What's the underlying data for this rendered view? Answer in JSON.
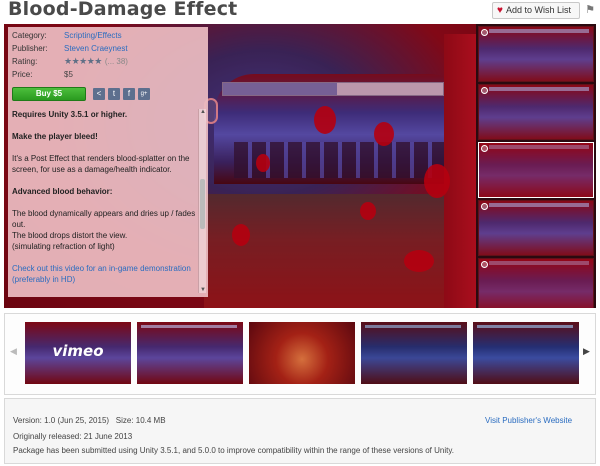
{
  "header": {
    "title": "Blood-Damage Effect",
    "wishlist_label": "Add to Wish List",
    "wishlist_icon": "heart-icon",
    "flag_icon": "flag-icon"
  },
  "info": {
    "category_label": "Category:",
    "category_value": "Scripting/Effects",
    "publisher_label": "Publisher:",
    "publisher_value": "Steven Craeynest",
    "rating_label": "Rating:",
    "rating_stars": "★★★★★",
    "rating_count": "(... 38)",
    "price_label": "Price:",
    "price_value": "$5",
    "buy_label": "Buy $5",
    "share_icons": [
      "share-icon",
      "twitter-icon",
      "facebook-icon",
      "google-plus-icon"
    ],
    "share_glyphs": [
      "<",
      "t",
      "f",
      "g+"
    ]
  },
  "description": {
    "line1": "Requires Unity 3.5.1 or higher.",
    "line2": "Make the player bleed!",
    "line3": "It's a Post Effect that renders blood-splatter on the screen, for use as a damage/health indicator.",
    "line4": "Advanced blood behavior:",
    "line5": "The blood dynamically appears and dries up / fades out.",
    "line6": "The blood drops distort the view.",
    "line7": "(simulating refraction of light)",
    "line8": "Check out this video for an in-game demonstration (preferably in HD)"
  },
  "carousel": {
    "prev_icon": "chevron-left-icon",
    "next_icon": "chevron-right-icon",
    "prev_glyph": "◀",
    "next_glyph": "▶",
    "vimeo_label": "vimeo"
  },
  "footer": {
    "version_line": "Version: 1.0 (Jun 25, 2015)   Size: 10.4 MB",
    "released_line": "Originally released: 21 June 2013",
    "package_line": "Package has been submitted using Unity 3.5.1, and 5.0.0 to improve compatibility within the range of these versions of Unity.",
    "publisher_link": "Visit Publisher's Website"
  },
  "colors": {
    "accent_link": "#2a6cc0",
    "buy_green": "#2a9a1f",
    "blood_red": "#b5000f"
  }
}
